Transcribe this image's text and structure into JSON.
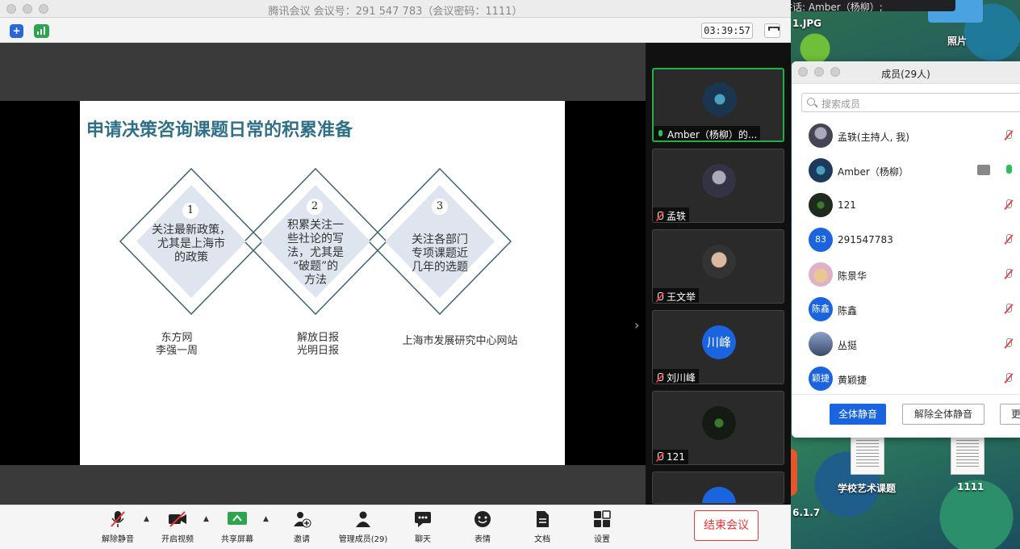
{
  "window": {
    "title": "腾讯会议 会议号：291 547 783（会议密码：1111）",
    "timer": "03:39:57"
  },
  "slide": {
    "title": "申请决策咨询课题日常的积累准备",
    "items": [
      {
        "num": "1",
        "text": "关注最新政策，尤其是上海市的政策",
        "lines": [
          "关注最新政策，",
          "尤其是上海市",
          "的政策"
        ],
        "sources": [
          "东方网",
          "李强一周"
        ]
      },
      {
        "num": "2",
        "text": "积累关注一些社论的写法，尤其是“破题”的方法",
        "lines": [
          "积累关注一",
          "些社论的写",
          "法，尤其是",
          "“破题”的",
          "方法"
        ],
        "sources": [
          "解放日报",
          "光明日报"
        ]
      },
      {
        "num": "3",
        "text": "关注各部门专项课题近几年的选题",
        "lines": [
          "关注各部门",
          "专项课题近",
          "几年的选题"
        ],
        "sources": [
          "上海市发展研究中心网站"
        ]
      }
    ]
  },
  "gallery": [
    {
      "name": "Amber（杨柳）的...",
      "mic": "on",
      "active": true
    },
    {
      "name": "孟轶",
      "mic": "muted",
      "active": false
    },
    {
      "name": "王文举",
      "mic": "muted",
      "active": false
    },
    {
      "name": "刘川峰",
      "mic": "muted",
      "active": false,
      "avatar_text": "川峰"
    },
    {
      "name": "121",
      "mic": "muted",
      "active": false
    }
  ],
  "toolbar": {
    "unmute": "解除静音",
    "video": "开启视频",
    "share": "共享屏幕",
    "invite": "邀请",
    "members": "管理成员(29)",
    "chat": "聊天",
    "reactions": "表情",
    "docs": "文档",
    "settings": "设置",
    "end": "结束会议"
  },
  "members_panel": {
    "title": "成员(29人)",
    "search_placeholder": "搜索成员",
    "members": [
      {
        "name": "孟轶(主持人, 我)",
        "avatar_text": "",
        "avatar_color": "#555555",
        "mic": "muted"
      },
      {
        "name": "Amber（杨柳）",
        "avatar_text": "",
        "avatar_color": "#1b3a5c",
        "mic": "on",
        "sharing": true
      },
      {
        "name": "121",
        "avatar_text": "",
        "avatar_color": "#1e2b1e",
        "mic": "muted"
      },
      {
        "name": "291547783",
        "avatar_text": "83",
        "avatar_color": "#1a64e0",
        "mic": "muted"
      },
      {
        "name": "陈景华",
        "avatar_text": "",
        "avatar_color": "#e0b0c8",
        "mic": "muted"
      },
      {
        "name": "陈鑫",
        "avatar_text": "陈鑫",
        "avatar_color": "#1a64e0",
        "mic": "muted"
      },
      {
        "name": "丛挺",
        "avatar_text": "",
        "avatar_color": "#3a4a6a",
        "mic": "muted"
      },
      {
        "name": "黄颖捷",
        "avatar_text": "颖捷",
        "avatar_color": "#1a64e0",
        "mic": "muted"
      }
    ],
    "mute_all": "全体静音",
    "unmute_all": "解除全体静音",
    "more": "更"
  },
  "desktop": {
    "notice": "正在讲话: Amber（杨柳）;",
    "file1": "1.JPG",
    "photos": "照片",
    "file2": "学校艺术课题",
    "file3": "1111",
    "file4": "6.1.7"
  }
}
